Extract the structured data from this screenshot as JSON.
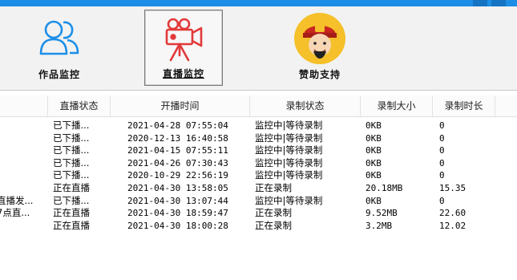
{
  "toolbar": {
    "items": [
      {
        "label": "作品监控",
        "icon": "users-icon"
      },
      {
        "label": "直播监控",
        "icon": "video-camera-icon"
      },
      {
        "label": "赞助支持",
        "icon": "fortune-god-icon"
      }
    ],
    "active_index": 1
  },
  "table": {
    "columns": [
      "直播状态",
      "开播时间",
      "录制状态",
      "录制大小",
      "录制时长"
    ],
    "rows": [
      {
        "name": "",
        "status": "已下播...",
        "start": "2021-04-28 07:55:04",
        "rec_state": "监控中|等待录制",
        "size": "0KB",
        "duration": "0"
      },
      {
        "name": "",
        "status": "已下播...",
        "start": "2020-12-13 16:40:58",
        "rec_state": "监控中|等待录制",
        "size": "0KB",
        "duration": "0"
      },
      {
        "name": "",
        "status": "已下播...",
        "start": "2021-04-15 07:55:11",
        "rec_state": "监控中|等待录制",
        "size": "0KB",
        "duration": "0"
      },
      {
        "name": "",
        "status": "已下播...",
        "start": "2021-04-26 07:30:43",
        "rec_state": "监控中|等待录制",
        "size": "0KB",
        "duration": "0"
      },
      {
        "name": "",
        "status": "已下播...",
        "start": "2020-10-29 22:56:19",
        "rec_state": "监控中|等待录制",
        "size": "0KB",
        "duration": "0"
      },
      {
        "name": "",
        "status": "正在直播",
        "start": "2021-04-30 13:58:05",
        "rec_state": "正在录制",
        "size": "20.18MB",
        "duration": "15.35"
      },
      {
        "name": "直播发...",
        "status": "已下播...",
        "start": "2021-04-30 13:07:44",
        "rec_state": "监控中|等待录制",
        "size": "0KB",
        "duration": "0"
      },
      {
        "name": "7点直...",
        "status": "正在直播",
        "start": "2021-04-30 18:59:47",
        "rec_state": "正在录制",
        "size": "9.52MB",
        "duration": "22.60"
      },
      {
        "name": "",
        "status": "正在直播",
        "start": "2021-04-30 18:00:28",
        "rec_state": "正在录制",
        "size": "3.2MB",
        "duration": "12.02"
      }
    ]
  },
  "colors": {
    "titlebar": "#1c8ee6",
    "icon_blue": "#1d8fe8",
    "icon_red": "#e23a3a",
    "coin_gold": "#f5c02a"
  }
}
